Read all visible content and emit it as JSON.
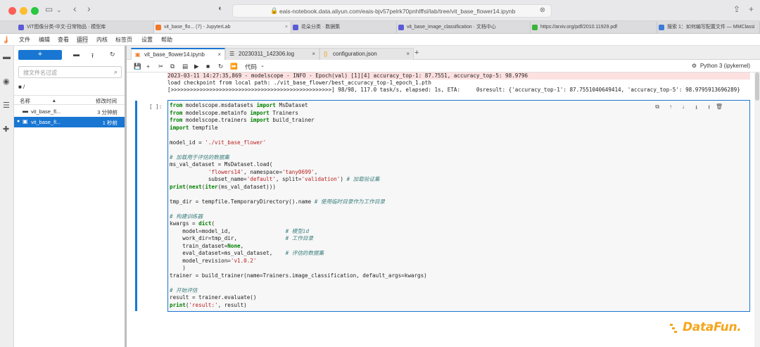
{
  "browser": {
    "url": "eais-notebook.data.aliyun.com/eais-bjv57pelrk70pnhlffsl/lab/tree/vit_base_flower14.ipynb",
    "tabs": [
      {
        "label": "ViT图像分类-中文-日常物品 · 模型库",
        "fav_color": "#5b5bd6"
      },
      {
        "label": "vit_base_flo... (7) - JupyterLab",
        "fav_color": "#f37726"
      },
      {
        "label": "花朵分类 · 数据集",
        "fav_color": "#5b5bd6"
      },
      {
        "label": "vit_base_image_classification · 文档中心",
        "fav_color": "#5b5bd6"
      },
      {
        "label": "https://arxiv.org/pdf/2010.11929.pdf",
        "fav_color": "#3db23d"
      },
      {
        "label": "搜索 1：如何编写配置文件 — MMClassi",
        "fav_color": "#3c7bd9"
      }
    ]
  },
  "menu": [
    "文件",
    "编辑",
    "查看",
    "运行",
    "内核",
    "标签页",
    "设置",
    "帮助"
  ],
  "filebrowser": {
    "new_label": "+",
    "search_placeholder": "搜文件名过滤",
    "breadcrumb": "■ /",
    "col_name": "名称",
    "col_modified": "修改时间",
    "files": [
      {
        "name": "vit_base_fl...",
        "time": "3 分钟前",
        "icon": "folder",
        "selected": false
      },
      {
        "name": "vit_base_fl...",
        "time": "1 秒前",
        "icon": "notebook",
        "selected": true
      }
    ]
  },
  "doc_tabs": [
    {
      "label": "vit_base_flower14.ipynb",
      "active": true
    },
    {
      "label": "20230311_142306.log",
      "active": false
    },
    {
      "label": "configuration.json",
      "active": false
    }
  ],
  "toolbar": {
    "cell_type": "代码",
    "kernel": "Python 3 (ipykernel)"
  },
  "output_lines": [
    "2023-03-11 14:27:35,869 - modelscope - INFO - Epoch(val) [1][4] accuracy_top-1: 87.7551, accuracy_top-5: 98.9796",
    "load checkpoint from local path: ./vit_base_flower/best_accuracy_top-1_epoch_1.pth",
    "[>>>>>>>>>>>>>>>>>>>>>>>>>>>>>>>>>>>>>>>>>>>>>>>>>>] 98/98, 117.0 task/s, elapsed: 1s, ETA:     0sresult: {'accuracy_top-1': 87.7551040649414, 'accuracy_top-5': 98.9795913696289}"
  ],
  "cell_prompt": "[ ]:",
  "code_lines": [
    "from modelscope.msdatasets import MsDataset",
    "from modelscope.metainfo import Trainers",
    "from modelscope.trainers import build_trainer",
    "import tempfile",
    "",
    "model_id = './vit_base_flower'",
    "",
    "# 加载用于评估的数据集",
    "ms_val_dataset = MsDataset.load(",
    "            'flowers14', namespace='tany0699',",
    "            subset_name='default', split='validation') # 加载验证集",
    "print(next(iter(ms_val_dataset)))",
    "",
    "tmp_dir = tempfile.TemporaryDirectory().name # 使用临时目录作为工作目录",
    "",
    "# 构建训练器",
    "kwargs = dict(",
    "    model=model_id,                 # 模型id",
    "    work_dir=tmp_dir,               # 工作目录",
    "    train_dataset=None,",
    "    eval_dataset=ms_val_dataset,    # 评估的数据集",
    "    model_revision='v1.0.2'",
    "    )",
    "trainer = build_trainer(name=Trainers.image_classification, default_args=kwargs)",
    "",
    "# 开始评估",
    "result = trainer.evaluate()",
    "print('result:', result)"
  ],
  "watermark": "DataFun."
}
